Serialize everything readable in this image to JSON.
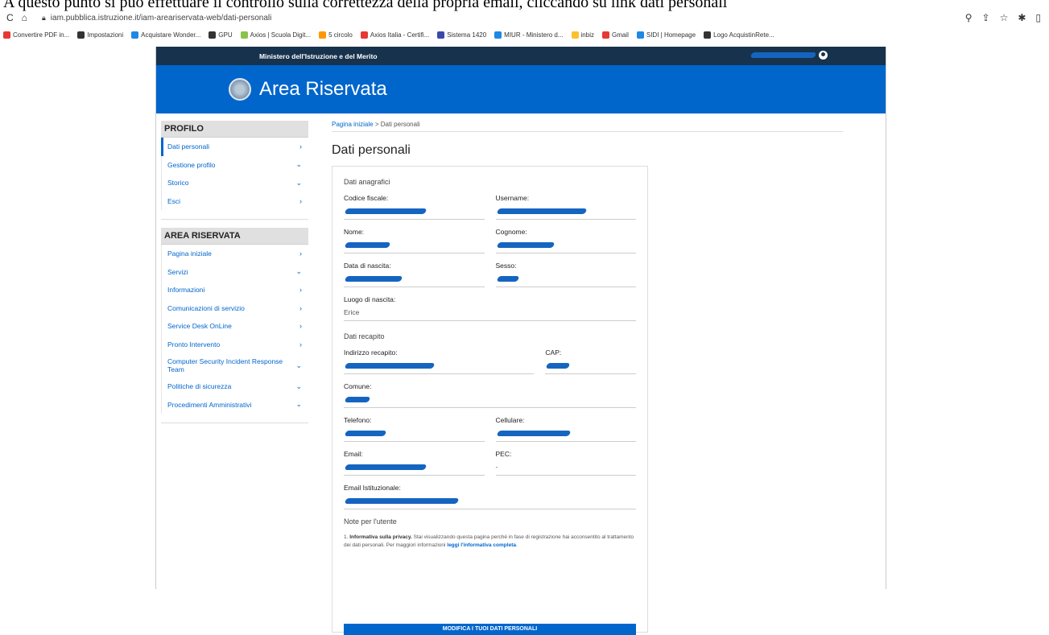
{
  "caption": "A questo punto si può effettuare il controllo sulla correttezza della propria email, cliccando su link dati personali",
  "browser": {
    "url": "iam.pubblica.istruzione.it/iam-areariservata-web/dati-personali",
    "bookmarks": [
      {
        "label": "Convertire PDF in...",
        "color": "#e53935"
      },
      {
        "label": "Impostazioni",
        "color": "#333333"
      },
      {
        "label": "Acquistare Wonder...",
        "color": "#1e88e5"
      },
      {
        "label": "GPU",
        "color": "#333333"
      },
      {
        "label": "Axios | Scuola Digit...",
        "color": "#8bc34a"
      },
      {
        "label": "5 circolo",
        "color": "#ff9800"
      },
      {
        "label": "Axios Italia - Certifi...",
        "color": "#e53935"
      },
      {
        "label": "Sistema 1420",
        "color": "#3949ab"
      },
      {
        "label": "MIUR - Ministero d...",
        "color": "#1e88e5"
      },
      {
        "label": "inbiz",
        "color": "#fbc02d"
      },
      {
        "label": "Gmail",
        "color": "#e53935"
      },
      {
        "label": "SIDI | Homepage",
        "color": "#1e88e5"
      },
      {
        "label": "Logo AcquistinRete...",
        "color": "#333333"
      }
    ]
  },
  "header": {
    "ministry": "Ministero dell'Istruzione e del Merito",
    "title": "Area Riservata"
  },
  "sidebar": {
    "profilo_title": "PROFILO",
    "profilo_items": [
      {
        "label": "Dati personali",
        "chevron": "›"
      },
      {
        "label": "Gestione profilo",
        "chevron": "⌄"
      },
      {
        "label": "Storico",
        "chevron": "⌄"
      },
      {
        "label": "Esci",
        "chevron": "›"
      }
    ],
    "area_title": "AREA RISERVATA",
    "area_items": [
      {
        "label": "Pagina iniziale",
        "chevron": "›"
      },
      {
        "label": "Servizi",
        "chevron": "⌄"
      },
      {
        "label": "Informazioni",
        "chevron": "›"
      },
      {
        "label": "Comunicazioni di servizio",
        "chevron": "›"
      },
      {
        "label": "Service Desk OnLine",
        "chevron": "›"
      },
      {
        "label": "Pronto Intervento",
        "chevron": "›"
      },
      {
        "label": "Computer Security Incident Response Team",
        "chevron": "⌄"
      },
      {
        "label": "Politiche di sicurezza",
        "chevron": "⌄"
      },
      {
        "label": "Procedimenti Amministrativi",
        "chevron": "⌄"
      }
    ]
  },
  "main": {
    "breadcrumb_home": "Pagina iniziale",
    "breadcrumb_sep": " > ",
    "breadcrumb_current": "Dati personali",
    "title": "Dati personali",
    "section_anagrafici": "Dati anagrafici",
    "codice_fiscale": "Codice fiscale:",
    "username": "Username:",
    "nome": "Nome:",
    "cognome": "Cognome:",
    "data_nascita": "Data di nascita:",
    "sesso": "Sesso:",
    "luogo_nascita": "Luogo di nascita:",
    "luogo_nascita_val": "Erice",
    "section_recapito": "Dati recapito",
    "indirizzo": "Indirizzo recapito:",
    "cap": "CAP:",
    "comune": "Comune:",
    "telefono": "Telefono:",
    "cellulare": "Cellulare:",
    "email": "Email:",
    "pec": "PEC:",
    "pec_val": "-",
    "email_ist": "Email Istituzionale:",
    "notes_title": "Note per l'utente",
    "note_prefix": "1.",
    "note_bold": "Informativa sulla privacy.",
    "note_text": " Stai visualizzando questa pagina perché in fase di registrazione hai acconsentito al trattamento dei dati personali. Per maggiori informazioni ",
    "note_link": "leggi l'informativa completa",
    "note_end": ".",
    "edit_button": "MODIFICA I TUOI DATI PERSONALI"
  }
}
